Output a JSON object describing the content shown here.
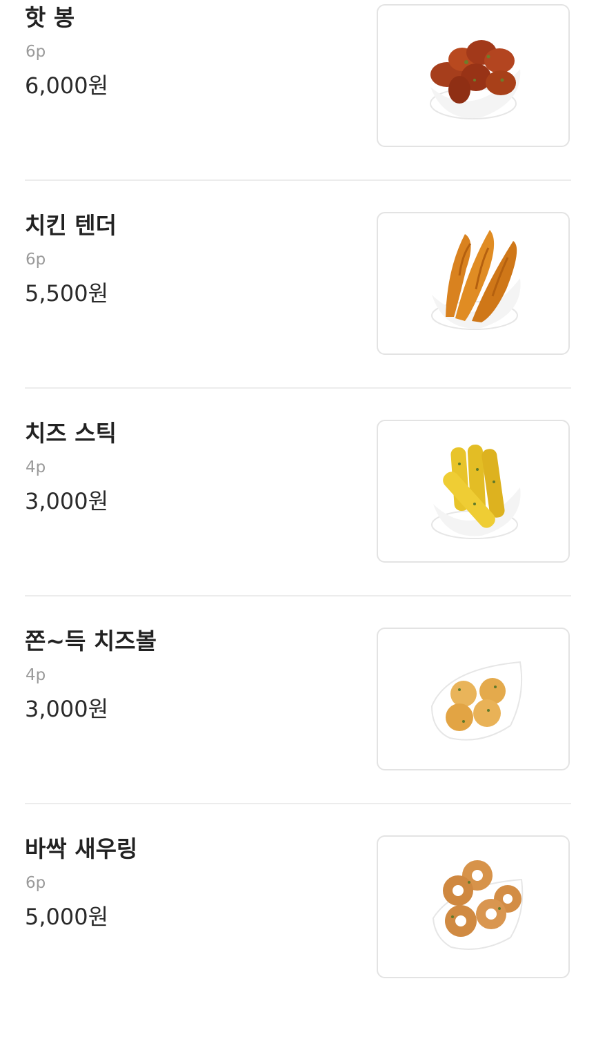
{
  "menu": {
    "items": [
      {
        "name": "핫 봉",
        "quantity": "6p",
        "price": "6,000원",
        "image_icon": "hot-wings-icon"
      },
      {
        "name": "치킨 텐더",
        "quantity": "6p",
        "price": "5,500원",
        "image_icon": "chicken-tender-icon"
      },
      {
        "name": "치즈 스틱",
        "quantity": "4p",
        "price": "3,000원",
        "image_icon": "cheese-stick-icon"
      },
      {
        "name": "쫀~득 치즈볼",
        "quantity": "4p",
        "price": "3,000원",
        "image_icon": "cheese-ball-icon"
      },
      {
        "name": "바싹 새우링",
        "quantity": "6p",
        "price": "5,000원",
        "image_icon": "shrimp-ring-icon"
      }
    ]
  },
  "colors": {
    "name_text": "#222222",
    "quantity_text": "#9a9a9a",
    "price_text": "#2a2a2a",
    "card_border": "#e3e3e3",
    "divider": "#ececec"
  }
}
